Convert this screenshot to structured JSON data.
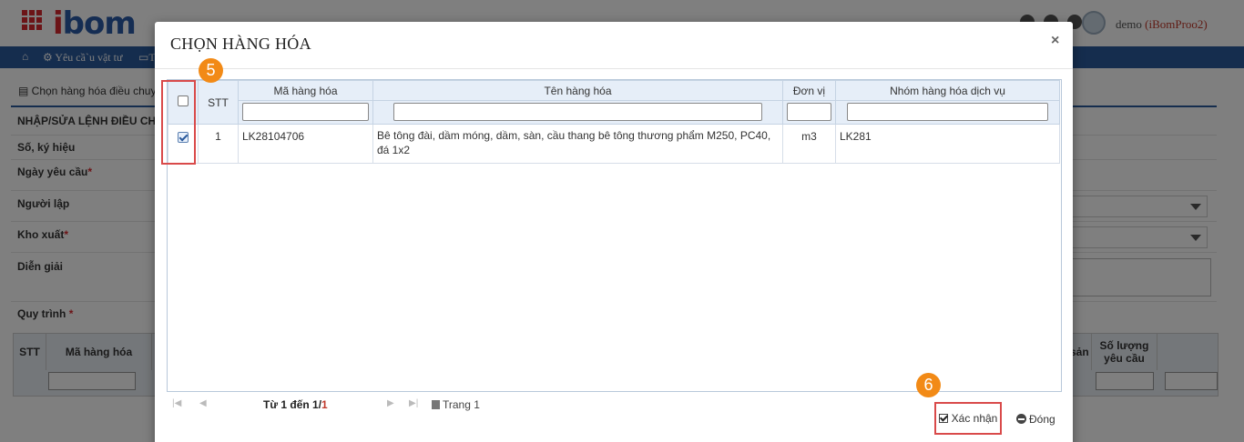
{
  "app": {
    "logo_text": "bom",
    "logo_prefix": "i",
    "user_name": "demo",
    "user_account": "(iBomProo2)"
  },
  "nav": {
    "item1": "Yêu cầ`u vật tư",
    "item2": "T"
  },
  "page": {
    "breadcrumb": "Chọn hàng hóa điều chuy",
    "form_title": "NHẬP/SỬA LỆNH ĐIỀU CHU",
    "fields": {
      "so_ky_hieu": "Số, ký hiệu",
      "ngay_yeu_cau": "Ngày yêu cầu",
      "nguoi_lap": "Người lập",
      "kho_xuat": "Kho xuất",
      "dien_giai": "Diễn giải",
      "quy_trinh": "Quy trình"
    },
    "required_mark": "*",
    "bg_table": {
      "stt": "STT",
      "ma_hang_hoa": "Mã hàng hóa",
      "san": "sản",
      "so_luong_yeu_cau": "Số lượng yêu cầu"
    }
  },
  "modal": {
    "title": "CHỌN HÀNG HÓA",
    "close": "×",
    "columns": {
      "stt": "STT",
      "ma_hang_hoa": "Mã hàng hóa",
      "ten_hang_hoa": "Tên hàng hóa",
      "don_vi": "Đơn vị",
      "nhom": "Nhóm hàng hóa dịch vụ"
    },
    "rows": [
      {
        "checked": true,
        "stt": "1",
        "ma_hang_hoa": "LK28104706",
        "ten_hang_hoa": "Bê tông đài, dầm móng, dầm, sàn, cầu thang bê tông thương phẩm M250, PC40, đá 1x2",
        "don_vi": "m3",
        "nhom": "LK281"
      }
    ],
    "pager": {
      "info_prefix": "Từ 1 đến 1/",
      "info_total": "1",
      "page_label": "Trang 1"
    },
    "buttons": {
      "confirm": "Xác nhận",
      "close": "Đóng"
    }
  },
  "annotations": {
    "step_select": "5",
    "step_confirm": "6"
  }
}
